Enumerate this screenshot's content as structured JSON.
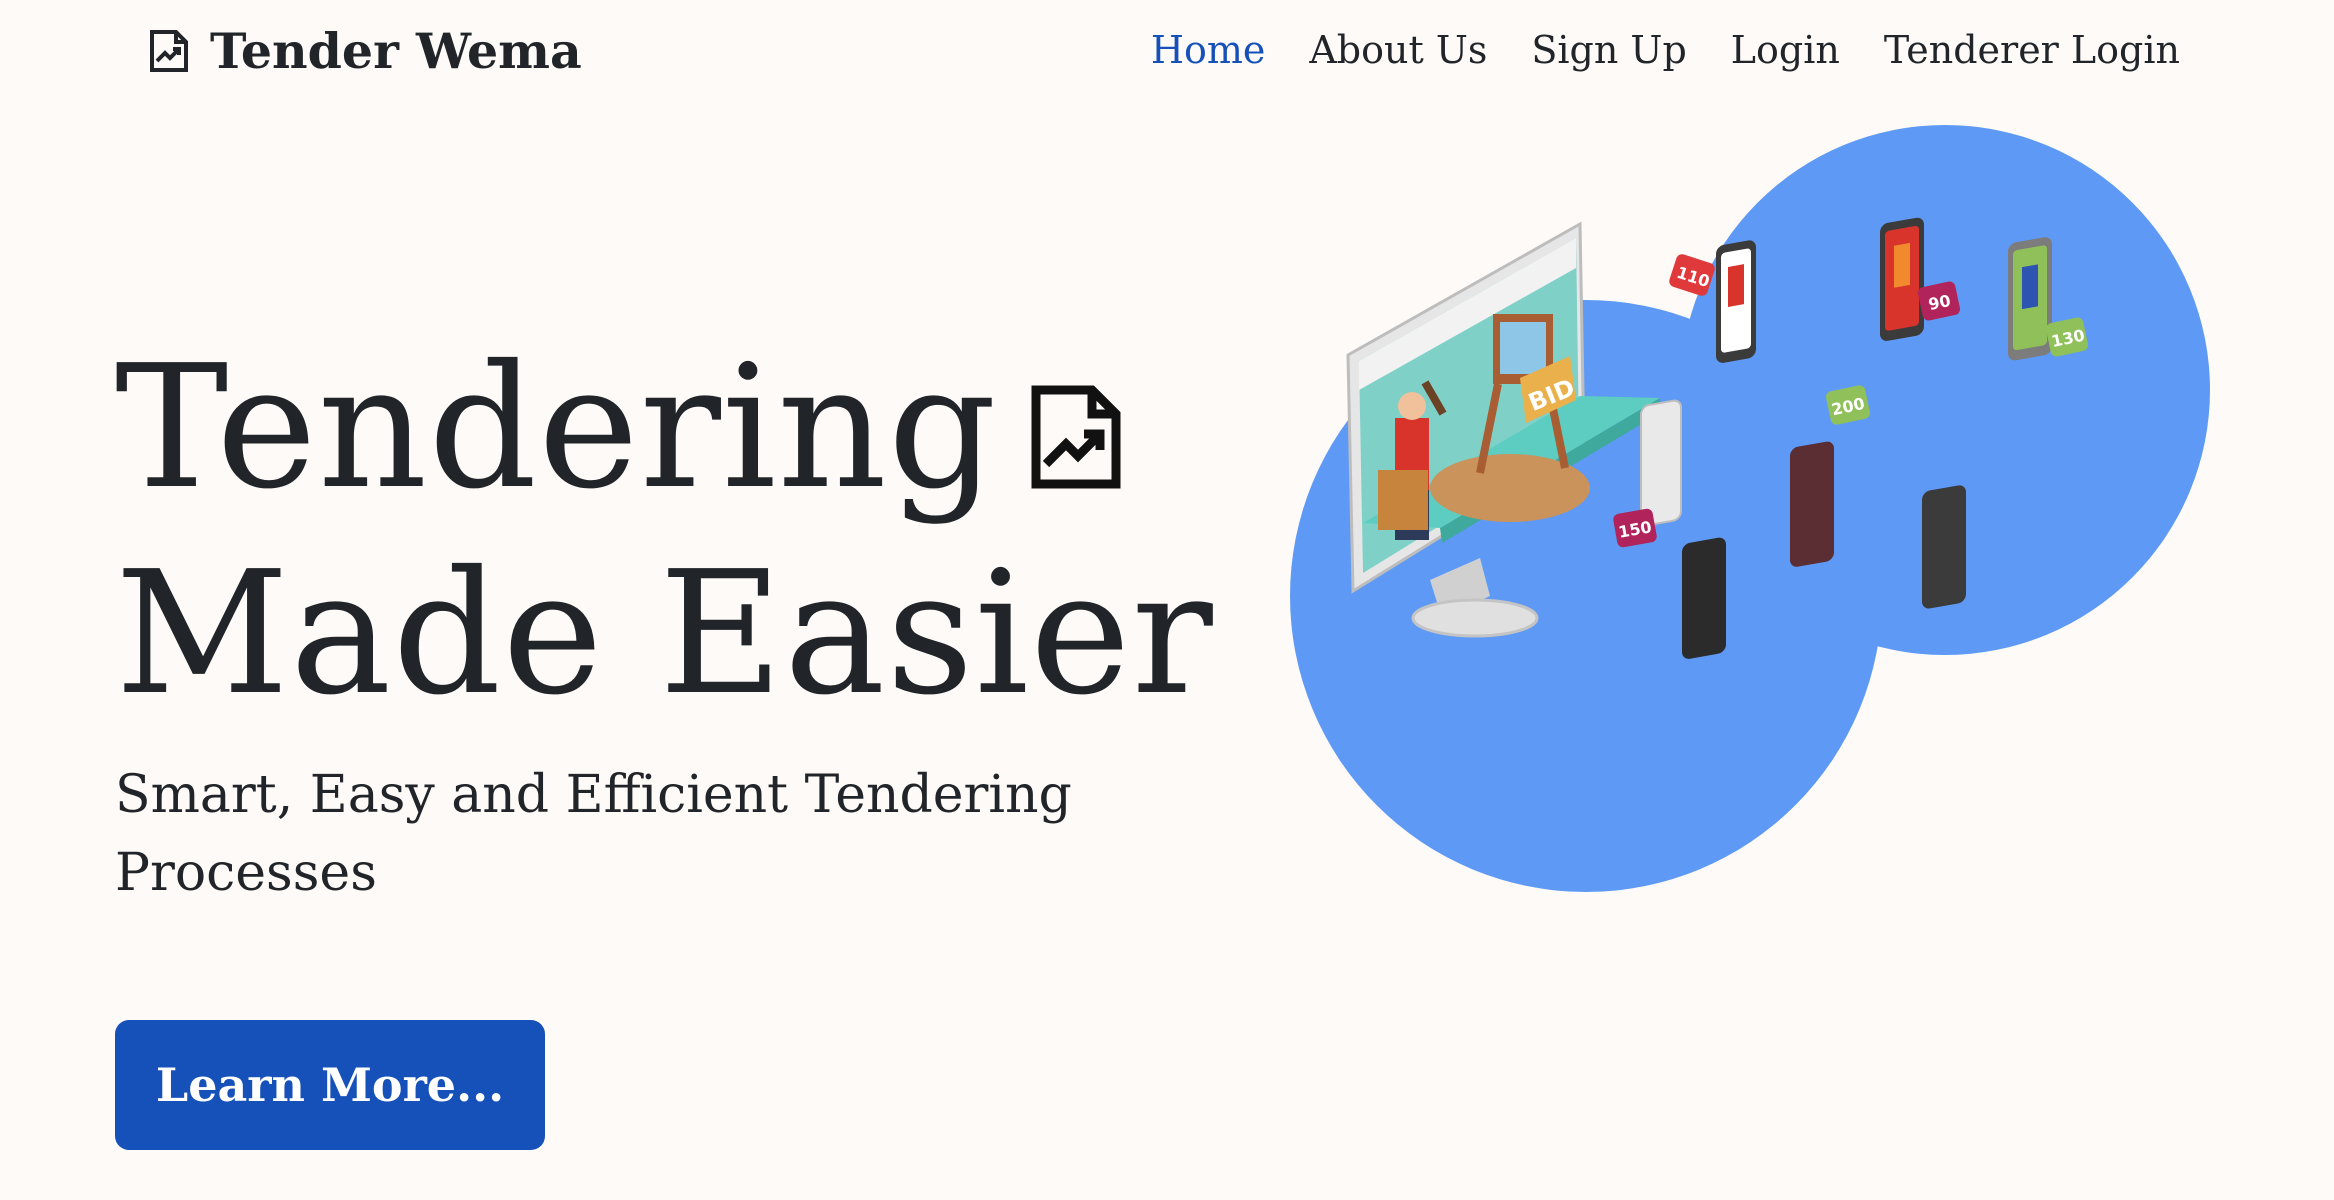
{
  "brand": {
    "name": "Tender Wema",
    "icon": "file-chart-icon"
  },
  "nav": {
    "items": [
      {
        "label": "Home",
        "active": true
      },
      {
        "label": "About Us",
        "active": false
      },
      {
        "label": "Sign Up",
        "active": false
      },
      {
        "label": "Login",
        "active": false
      },
      {
        "label": "Tenderer Login",
        "active": false
      }
    ]
  },
  "hero": {
    "title_line1": "Tendering",
    "title_line2": "Made Easier",
    "subtitle": "Smart, Easy and Efficient Tendering Processes",
    "cta_label": "Learn More...",
    "title_icon": "file-chart-icon"
  },
  "illustration": {
    "bid_sign": "BID",
    "bid_tags": [
      "110",
      "90",
      "130",
      "200",
      "150"
    ]
  },
  "colors": {
    "accent": "#1650b9",
    "circle": "#5e9af5",
    "background": "#fdfaf7",
    "text": "#212529"
  }
}
